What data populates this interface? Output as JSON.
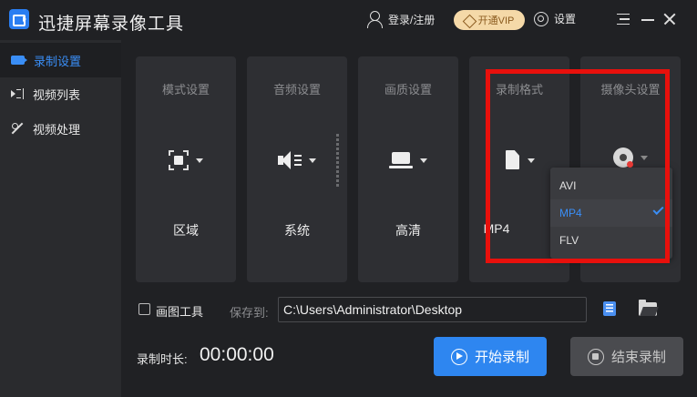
{
  "app": {
    "title": "迅捷屏幕录像工具",
    "login_label": "登录/注册",
    "vip_label": "开通VIP",
    "settings_label": "设置"
  },
  "sidebar": {
    "items": [
      {
        "label": "录制设置",
        "icon": "camera-icon",
        "active": true
      },
      {
        "label": "视频列表",
        "icon": "video-list-icon",
        "active": false
      },
      {
        "label": "视频处理",
        "icon": "tools-icon",
        "active": false
      }
    ]
  },
  "cards": [
    {
      "title": "模式设置",
      "value": "区域",
      "icon": "region-select-icon"
    },
    {
      "title": "音频设置",
      "value": "系统",
      "icon": "speaker-icon"
    },
    {
      "title": "画质设置",
      "value": "高清",
      "icon": "laptop-icon"
    },
    {
      "title": "录制格式",
      "value": "MP4",
      "icon": "file-icon"
    },
    {
      "title": "摄像头设置",
      "value": "",
      "icon": "webcam-icon"
    }
  ],
  "format_dropdown": {
    "options": [
      "AVI",
      "MP4",
      "FLV"
    ],
    "selected": "MP4"
  },
  "bottom": {
    "draw_tool_label": "画图工具",
    "draw_tool_checked": false,
    "save_to_label": "保存到:",
    "save_path": "C:\\Users\\Administrator\\Desktop",
    "duration_label": "录制时长:",
    "duration_value": "00:00:00",
    "start_label": "开始录制",
    "stop_label": "结束录制"
  },
  "colors": {
    "accent": "#2e86f0",
    "background": "#202124",
    "card": "#2e2f33",
    "highlight": "#e8100c",
    "vip": "#f5d9a8"
  }
}
